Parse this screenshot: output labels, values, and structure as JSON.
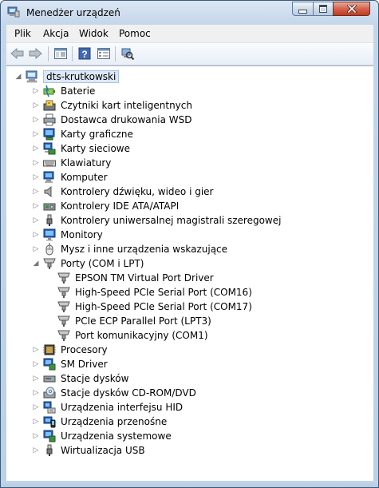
{
  "window": {
    "title": "Menedżer urządzeń"
  },
  "menu": [
    {
      "label": "Plik",
      "name": "menu-plik"
    },
    {
      "label": "Akcja",
      "name": "menu-akcja"
    },
    {
      "label": "Widok",
      "name": "menu-widok"
    },
    {
      "label": "Pomoc",
      "name": "menu-pomoc"
    }
  ],
  "toolbar": [
    {
      "icon": "back-arrow-icon",
      "name": "back-button"
    },
    {
      "icon": "forward-arrow-icon",
      "name": "forward-button"
    },
    {
      "icon": "device-view-icon",
      "name": "show-hide-console-tree-button"
    },
    {
      "icon": "help-icon",
      "name": "help-button"
    },
    {
      "icon": "properties-icon",
      "name": "properties-button"
    },
    {
      "icon": "scan-hardware-icon",
      "name": "scan-hardware-button"
    }
  ],
  "tree": {
    "root": {
      "label": "dts-krutkowski",
      "icon": "computer-icon",
      "expanded": true
    },
    "categories": [
      {
        "label": "Baterie",
        "icon": "battery-icon",
        "expanded": false
      },
      {
        "label": "Czytniki kart inteligentnych",
        "icon": "smart-card-reader-icon",
        "expanded": false
      },
      {
        "label": "Dostawca drukowania WSD",
        "icon": "printer-icon",
        "expanded": false
      },
      {
        "label": "Karty graficzne",
        "icon": "display-adapter-icon",
        "expanded": false
      },
      {
        "label": "Karty sieciowe",
        "icon": "network-adapter-icon",
        "expanded": false
      },
      {
        "label": "Klawiatury",
        "icon": "keyboard-icon",
        "expanded": false
      },
      {
        "label": "Komputer",
        "icon": "computer-icon",
        "expanded": false
      },
      {
        "label": "Kontrolery dźwięku, wideo i gier",
        "icon": "speaker-icon",
        "expanded": false
      },
      {
        "label": "Kontrolery IDE ATA/ATAPI",
        "icon": "ide-controller-icon",
        "expanded": false
      },
      {
        "label": "Kontrolery uniwersalnej magistrali szeregowej",
        "icon": "usb-plug-icon",
        "expanded": false
      },
      {
        "label": "Monitory",
        "icon": "monitor-icon",
        "expanded": false
      },
      {
        "label": "Mysz i inne urządzenia wskazujące",
        "icon": "mouse-icon",
        "expanded": false
      },
      {
        "label": "Porty (COM i LPT)",
        "icon": "port-connector-icon",
        "expanded": true,
        "children": [
          {
            "label": "EPSON TM Virtual Port Driver",
            "icon": "port-connector-icon"
          },
          {
            "label": "High-Speed PCIe Serial Port (COM16)",
            "icon": "port-connector-icon"
          },
          {
            "label": "High-Speed PCIe Serial Port (COM17)",
            "icon": "port-connector-icon"
          },
          {
            "label": "PCIe ECP Parallel Port (LPT3)",
            "icon": "port-connector-icon"
          },
          {
            "label": "Port komunikacyjny (COM1)",
            "icon": "port-connector-icon"
          }
        ]
      },
      {
        "label": "Procesory",
        "icon": "processor-icon",
        "expanded": false
      },
      {
        "label": "SM Driver",
        "icon": "system-device-icon",
        "expanded": false
      },
      {
        "label": "Stacje dysków",
        "icon": "disk-drive-icon",
        "expanded": false
      },
      {
        "label": "Stacje dysków CD-ROM/DVD",
        "icon": "cd-rom-icon",
        "expanded": false
      },
      {
        "label": "Urządzenia interfejsu HID",
        "icon": "hid-device-icon",
        "expanded": false
      },
      {
        "label": "Urządzenia przenośne",
        "icon": "portable-device-icon",
        "expanded": false
      },
      {
        "label": "Urządzenia systemowe",
        "icon": "system-device-icon",
        "expanded": false
      },
      {
        "label": "Wirtualizacja USB",
        "icon": "usb-plug-icon",
        "expanded": false
      }
    ]
  }
}
